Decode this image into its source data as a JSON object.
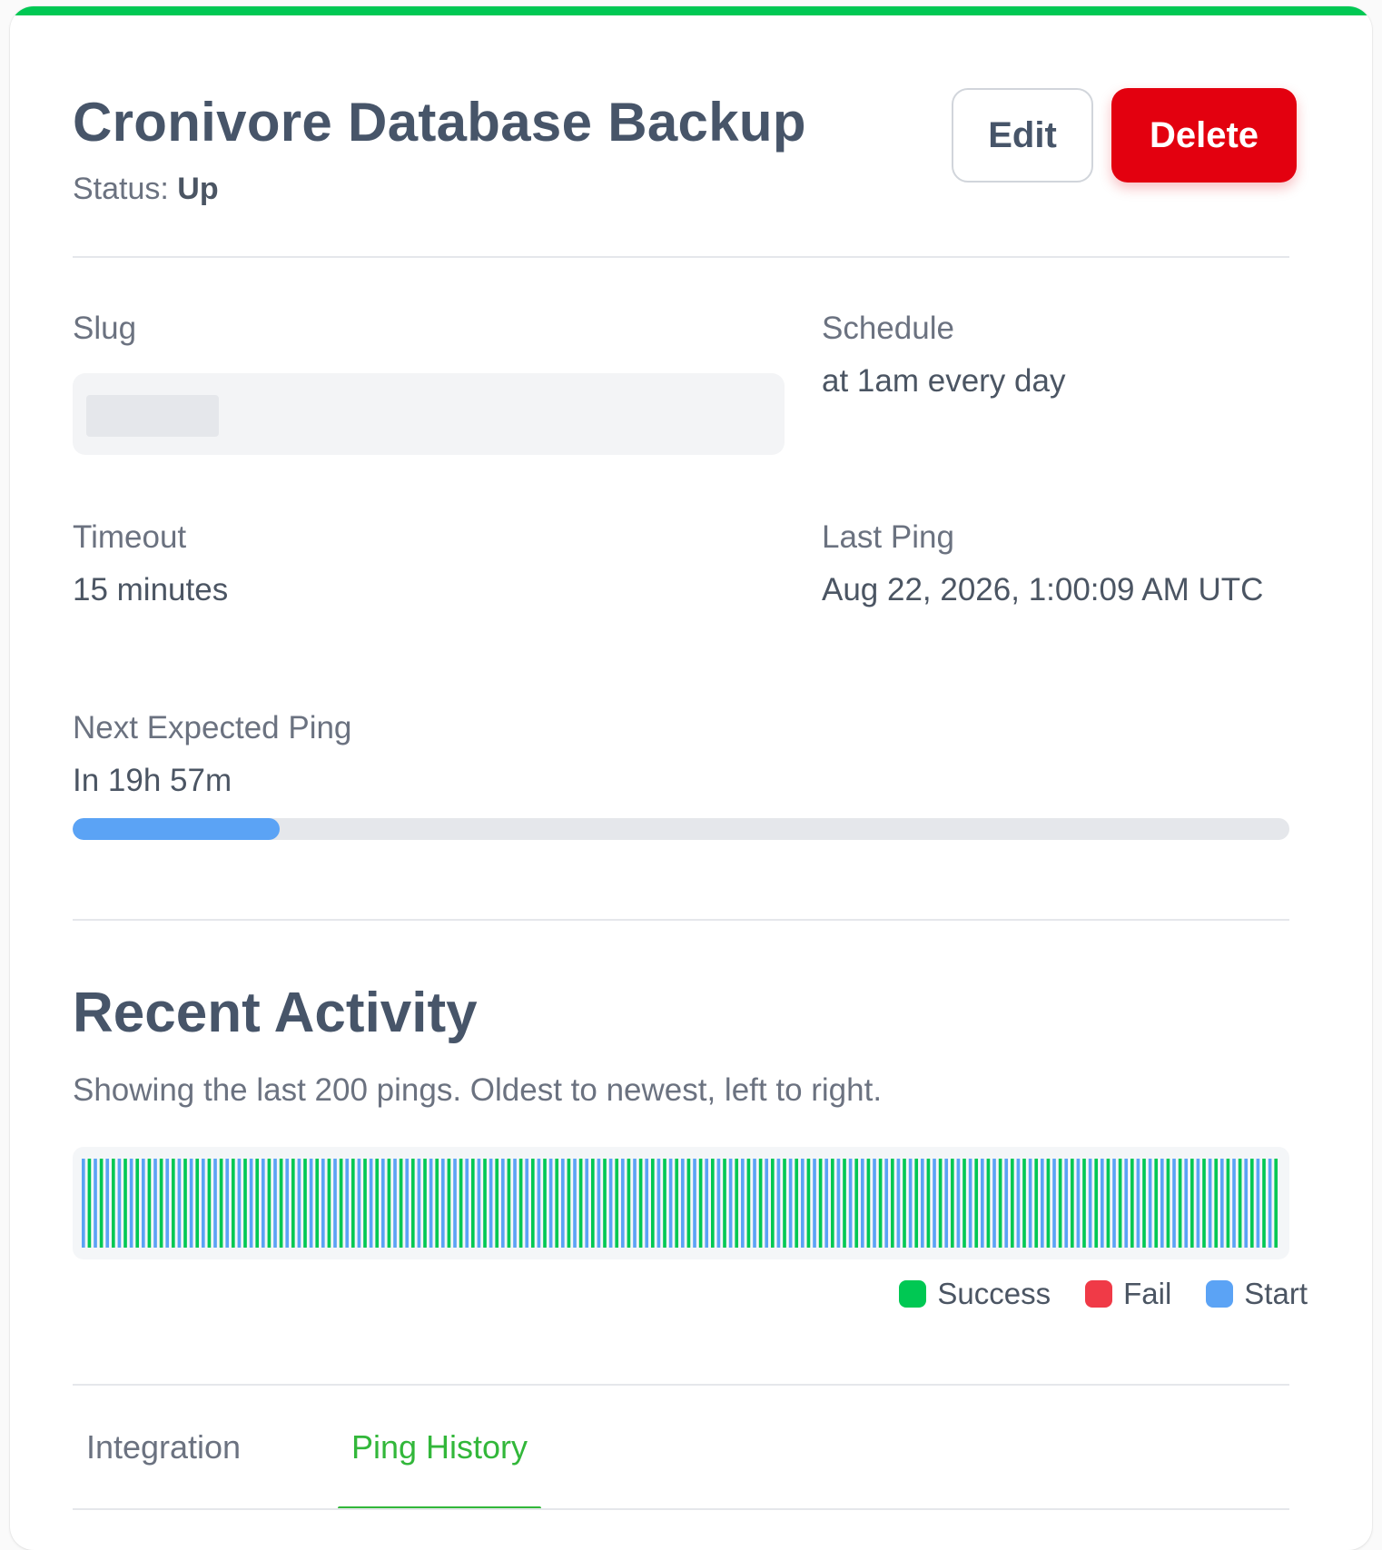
{
  "header": {
    "title": "Cronivore Database Backup",
    "status_label": "Status:",
    "status_value": "Up",
    "edit_label": "Edit",
    "delete_label": "Delete"
  },
  "fields": {
    "slug_label": "Slug",
    "slug_value": "",
    "schedule_label": "Schedule",
    "schedule_value": "at 1am every day",
    "timeout_label": "Timeout",
    "timeout_value": "15 minutes",
    "last_ping_label": "Last Ping",
    "last_ping_value": "Aug 22, 2026, 1:00:09 AM UTC",
    "next_ping_label": "Next Expected Ping",
    "next_ping_value": "In 19h 57m",
    "next_ping_progress": 0.17
  },
  "activity": {
    "title": "Recent Activity",
    "description": "Showing the last 200 pings. Oldest to newest, left to right.",
    "ping_count": 200,
    "legend": [
      {
        "label": "Success",
        "color": "#00c853"
      },
      {
        "label": "Fail",
        "color": "#f03a47"
      },
      {
        "label": "Start",
        "color": "#5ba3f5"
      }
    ]
  },
  "tabs": [
    {
      "label": "Integration",
      "active": false
    },
    {
      "label": "Ping History",
      "active": true
    }
  ],
  "colors": {
    "accent": "#00c853",
    "danger": "#e3000f",
    "progress": "#5ba3f5",
    "active_tab": "#32b73a"
  }
}
